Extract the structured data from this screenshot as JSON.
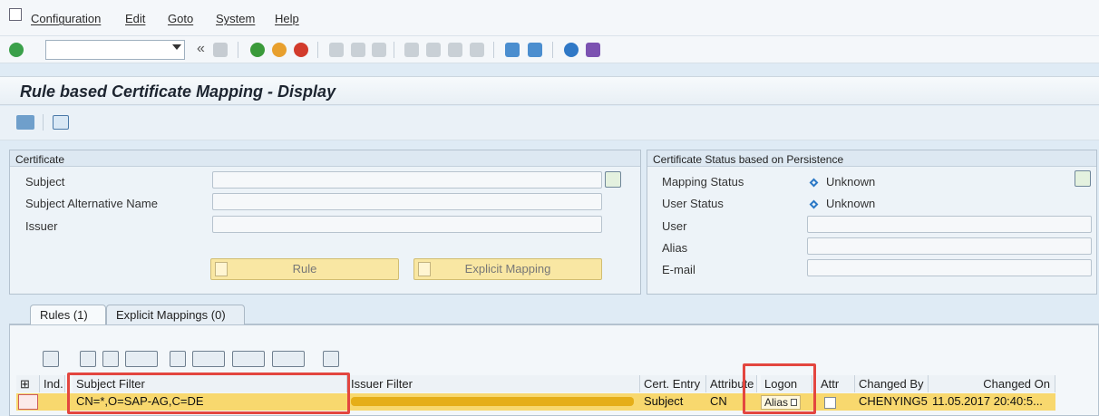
{
  "menu": {
    "icon": "menu-icon",
    "items": [
      "Configuration",
      "Edit",
      "Goto",
      "System",
      "Help"
    ]
  },
  "title": "Rule based Certificate Mapping - Display",
  "certificate": {
    "title": "Certificate",
    "labels": [
      "Subject",
      "Subject Alternative Name",
      "Issuer"
    ],
    "rule_button": "Rule",
    "explicit_button": "Explicit Mapping"
  },
  "status": {
    "title": "Certificate Status based on Persistence",
    "mapping_status_label": "Mapping Status",
    "mapping_status_value": "Unknown",
    "user_status_label": "User Status",
    "user_status_value": "Unknown",
    "user_label": "User",
    "alias_label": "Alias",
    "email_label": "E-mail"
  },
  "tabs": {
    "rules": "Rules (1)",
    "explicit": "Explicit Mappings (0)"
  },
  "table": {
    "headers": {
      "ind": "Ind.",
      "subject_filter": "Subject Filter",
      "issuer_filter": "Issuer Filter",
      "cert_entry": "Cert. Entry",
      "attribute": "Attribute",
      "logon": "Logon",
      "attr": "Attr",
      "changed_by": "Changed By",
      "changed_on": "Changed On"
    },
    "row": {
      "subject_filter": "CN=*,O=SAP-AG,C=DE",
      "cert_entry": "Subject",
      "attribute": "CN",
      "logon": "Alias",
      "changed_by": "CHENYING5",
      "changed_on": "11.05.2017 20:40:5..."
    }
  },
  "colors": {
    "highlight": "#f7d36b",
    "red_box": "#e3463f",
    "accent": "#2b78c6"
  }
}
